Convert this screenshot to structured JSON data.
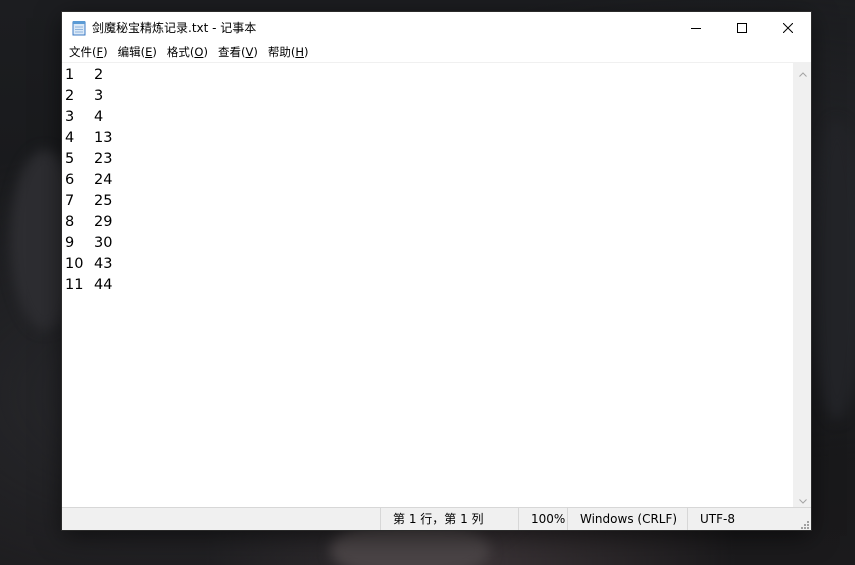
{
  "window": {
    "title": "剑魔秘宝精炼记录.txt - 记事本",
    "controls": {
      "minimize_icon": "minimize-icon",
      "maximize_icon": "maximize-icon",
      "close_icon": "close-icon"
    }
  },
  "menu": {
    "file": {
      "label": "文件(",
      "key": "F",
      "end": ")"
    },
    "edit": {
      "label": "编辑(",
      "key": "E",
      "end": ")"
    },
    "format": {
      "label": "格式(",
      "key": "O",
      "end": ")"
    },
    "view": {
      "label": "查看(",
      "key": "V",
      "end": ")"
    },
    "help": {
      "label": "帮助(",
      "key": "H",
      "end": ")"
    }
  },
  "document": {
    "lines": [
      {
        "a": "1",
        "b": "2"
      },
      {
        "a": "2",
        "b": "3"
      },
      {
        "a": "3",
        "b": "4"
      },
      {
        "a": "4",
        "b": "13"
      },
      {
        "a": "5",
        "b": "23"
      },
      {
        "a": "6",
        "b": "24"
      },
      {
        "a": "7",
        "b": "25"
      },
      {
        "a": "8",
        "b": "29"
      },
      {
        "a": "9",
        "b": "30"
      },
      {
        "a": "10",
        "b": "43"
      },
      {
        "a": "11",
        "b": "44"
      }
    ]
  },
  "status": {
    "position": "第 1 行，第 1 列",
    "zoom": "100%",
    "line_ending": "Windows (CRLF)",
    "encoding": "UTF-8"
  },
  "colors": {
    "titlebar": "#ffffff",
    "statusbar": "#f0f0f0",
    "icon": "#1f6fbf"
  }
}
